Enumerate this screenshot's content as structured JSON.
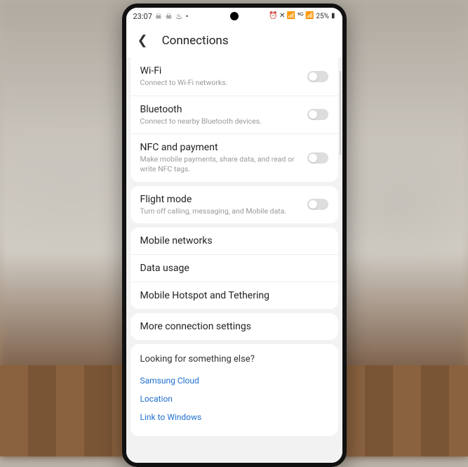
{
  "statusBar": {
    "time": "23:07",
    "leftIcons": "☠ ☠ ♨ •",
    "rightIcons": "⏰ ✕ 📶 ⁵ᴳ 📶",
    "battery": "25%",
    "batteryIcon": "▮"
  },
  "header": {
    "title": "Connections"
  },
  "sections": [
    {
      "rows": [
        {
          "id": "wifi",
          "title": "Wi-Fi",
          "sub": "Connect to Wi-Fi networks.",
          "toggle": true
        },
        {
          "id": "bluetooth",
          "title": "Bluetooth",
          "sub": "Connect to nearby Bluetooth devices.",
          "toggle": true
        },
        {
          "id": "nfc",
          "title": "NFC and payment",
          "sub": "Make mobile payments, share data, and read or write NFC tags.",
          "toggle": true
        }
      ]
    },
    {
      "rows": [
        {
          "id": "flight",
          "title": "Flight mode",
          "sub": "Turn off calling, messaging, and Mobile data.",
          "toggle": true
        }
      ]
    },
    {
      "rows": [
        {
          "id": "mobile-networks",
          "title": "Mobile networks",
          "sub": "",
          "toggle": false
        },
        {
          "id": "data-usage",
          "title": "Data usage",
          "sub": "",
          "toggle": false
        },
        {
          "id": "hotspot",
          "title": "Mobile Hotspot and Tethering",
          "sub": "",
          "toggle": false
        }
      ]
    },
    {
      "rows": [
        {
          "id": "more",
          "title": "More connection settings",
          "sub": "",
          "toggle": false
        }
      ]
    }
  ],
  "footer": {
    "title": "Looking for something else?",
    "links": [
      {
        "id": "samsung-cloud",
        "label": "Samsung Cloud"
      },
      {
        "id": "location",
        "label": "Location"
      },
      {
        "id": "link-windows",
        "label": "Link to Windows"
      }
    ]
  }
}
